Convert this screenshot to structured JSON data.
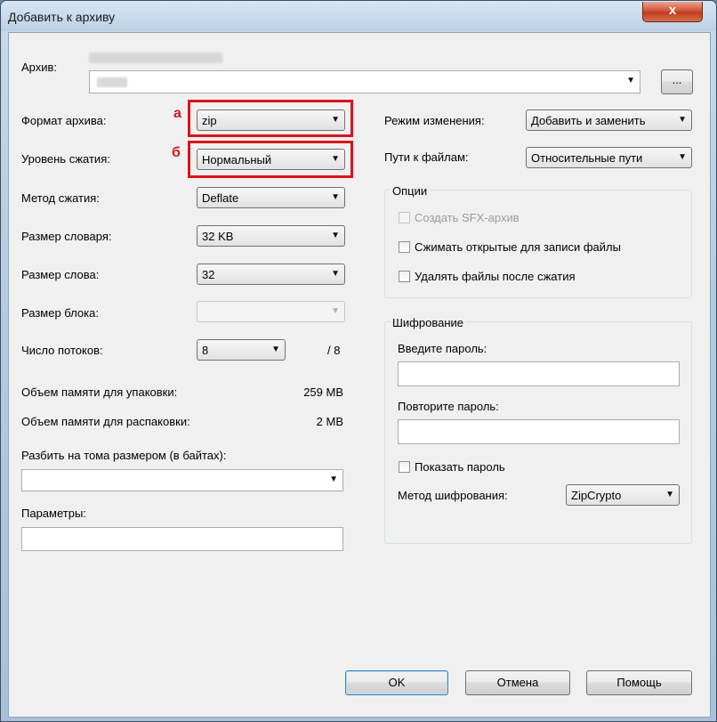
{
  "window": {
    "title": "Добавить к архиву",
    "close_glyph": "x"
  },
  "archive": {
    "label": "Архив:",
    "browse_label": "..."
  },
  "left": {
    "format": {
      "label": "Формат архива:",
      "value": "zip"
    },
    "level": {
      "label": "Уровень сжатия:",
      "value": "Нормальный"
    },
    "method": {
      "label": "Метод сжатия:",
      "value": "Deflate"
    },
    "dict": {
      "label": "Размер словаря:",
      "value": "32 KB"
    },
    "word": {
      "label": "Размер слова:",
      "value": "32"
    },
    "block": {
      "label": "Размер блока:",
      "value": ""
    },
    "threads": {
      "label": "Число потоков:",
      "value": "8",
      "max": "/ 8"
    },
    "mem_pack": {
      "label": "Объем памяти для упаковки:",
      "value": "259 MB"
    },
    "mem_unpack": {
      "label": "Объем памяти для распаковки:",
      "value": "2 MB"
    },
    "split": {
      "label": "Разбить на тома размером (в байтах):",
      "value": ""
    },
    "params": {
      "label": "Параметры:",
      "value": ""
    }
  },
  "right": {
    "update_mode": {
      "label": "Режим изменения:",
      "value": "Добавить и заменить"
    },
    "path_mode": {
      "label": "Пути к файлам:",
      "value": "Относительные пути"
    },
    "options": {
      "title": "Опции",
      "sfx": "Создать SFX-архив",
      "shared": "Сжимать открытые для записи файлы",
      "delete": "Удалять файлы после сжатия"
    },
    "encryption": {
      "title": "Шифрование",
      "password_label": "Введите пароль:",
      "repeat_label": "Повторите пароль:",
      "show_password": "Показать пароль",
      "method_label": "Метод шифрования:",
      "method_value": "ZipCrypto"
    }
  },
  "annotations": {
    "a": "а",
    "b": "б",
    "color": "#d9141b"
  },
  "buttons": {
    "ok": "OK",
    "cancel": "Отмена",
    "help": "Помощь"
  }
}
